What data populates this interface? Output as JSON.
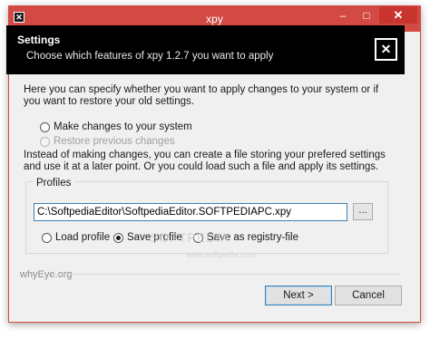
{
  "window": {
    "title": "xpy",
    "controls": {
      "minimize": "–",
      "maximize": "□",
      "close": "✕"
    }
  },
  "header": {
    "title": "Settings",
    "subtitle": "Choose which features of xpy 1.2.7 you want to apply",
    "close_glyph": "✕"
  },
  "intro": {
    "text": "Here you can specify whether you want to apply changes to your system or if you want to restore your old settings."
  },
  "mode_options": [
    {
      "label": "Make changes to your system",
      "checked": false,
      "disabled": false
    },
    {
      "label": "Restore previous changes",
      "checked": false,
      "disabled": true
    }
  ],
  "profile_info": {
    "text": "Instead of making changes, you can create a file storing your prefered settings and use it at a later point. Or you could load such a file and apply its settings."
  },
  "profiles": {
    "group_label": "Profiles",
    "path_value": "C:\\SoftpediaEditor\\SoftpediaEditor.SOFTPEDIAPC.xpy",
    "browse_label": "...",
    "options": [
      {
        "label": "Load profile",
        "checked": false
      },
      {
        "label": "Save profile",
        "checked": true
      },
      {
        "label": "Save as registry-file",
        "checked": false
      }
    ]
  },
  "watermark": {
    "text": "SOFTPEDIA",
    "sub": "www.softpedia.com"
  },
  "footer": {
    "brand": "whyEye.org",
    "next_label": "Next >",
    "cancel_label": "Cancel"
  },
  "colors": {
    "titlebar": "#d24a43",
    "header_bg": "#000000",
    "dialog_bg": "#f0f0f0",
    "focus_border": "#3c7fb1"
  }
}
